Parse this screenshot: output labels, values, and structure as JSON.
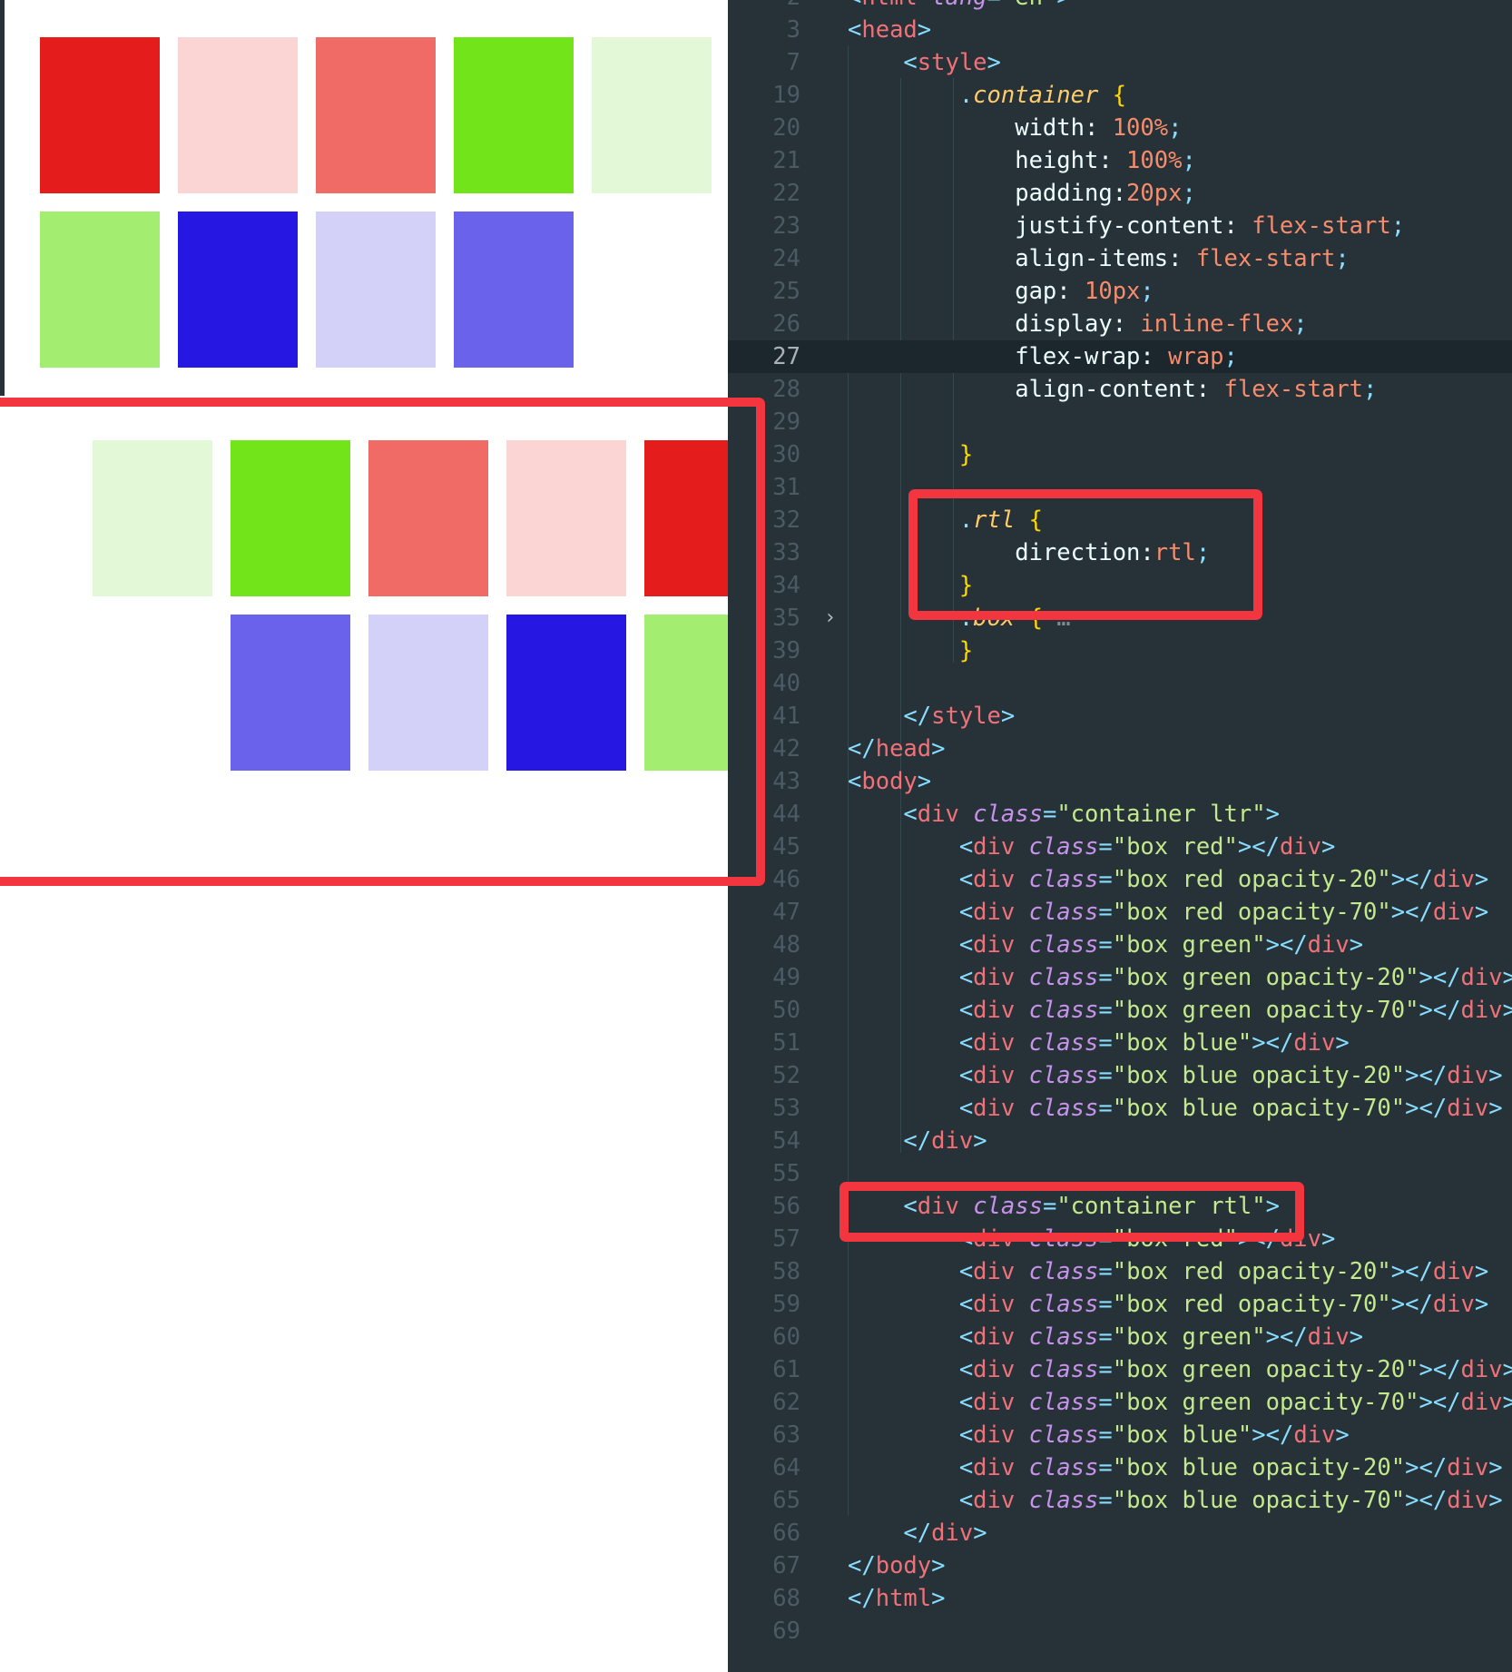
{
  "preview": {
    "colors": {
      "red": "#e41c1c",
      "red_20": "#fbd5d4",
      "red_70": "#f06a66",
      "green": "#72e51a",
      "green_20": "#e2f8d7",
      "green_70": "#a3ee70",
      "blue": "#2617e3",
      "blue_20": "#d4d1f8",
      "blue_70": "#6a62ea"
    },
    "ltr_boxes": [
      "red",
      "red_20",
      "red_70",
      "green",
      "green_20",
      "green_70",
      "blue",
      "blue_20",
      "blue_70"
    ],
    "rtl_boxes": [
      "red",
      "red_20",
      "red_70",
      "green",
      "green_20",
      "green_70",
      "blue",
      "blue_20",
      "blue_70"
    ],
    "highlight_color": "#f2353f"
  },
  "editor": {
    "current_line": 27,
    "lines": [
      {
        "n": 2,
        "c": [
          [
            "t-br",
            "<"
          ],
          [
            "t-tag",
            "html "
          ],
          [
            "t-attr",
            "lang"
          ],
          [
            "t-br",
            "="
          ],
          [
            "t-str",
            "\"en\""
          ],
          [
            "t-br",
            ">"
          ]
        ]
      },
      {
        "n": 3,
        "c": [
          [
            "t-br",
            "<"
          ],
          [
            "t-tag",
            "head"
          ],
          [
            "t-br",
            ">"
          ]
        ]
      },
      {
        "n": 7,
        "c": [
          [
            "t-br",
            "    <"
          ],
          [
            "t-tag",
            "style"
          ],
          [
            "t-br",
            ">"
          ]
        ]
      },
      {
        "n": 19,
        "c": [
          [
            "t-punc",
            "        ."
          ],
          [
            "t-sel",
            "container "
          ],
          [
            "t-curly",
            "{"
          ]
        ]
      },
      {
        "n": 20,
        "c": [
          [
            "t-prop",
            "            width: "
          ],
          [
            "t-num",
            "100%"
          ],
          [
            "t-punc",
            ";"
          ]
        ]
      },
      {
        "n": 21,
        "c": [
          [
            "t-prop",
            "            height: "
          ],
          [
            "t-num",
            "100%"
          ],
          [
            "t-punc",
            ";"
          ]
        ]
      },
      {
        "n": 22,
        "c": [
          [
            "t-prop",
            "            padding:"
          ],
          [
            "t-num",
            "20px"
          ],
          [
            "t-punc",
            ";"
          ]
        ]
      },
      {
        "n": 23,
        "c": [
          [
            "t-prop",
            "            justify-content: "
          ],
          [
            "t-val",
            "flex-start"
          ],
          [
            "t-punc",
            ";"
          ]
        ]
      },
      {
        "n": 24,
        "c": [
          [
            "t-prop",
            "            align-items: "
          ],
          [
            "t-val",
            "flex-start"
          ],
          [
            "t-punc",
            ";"
          ]
        ]
      },
      {
        "n": 25,
        "c": [
          [
            "t-prop",
            "            gap: "
          ],
          [
            "t-num",
            "10px"
          ],
          [
            "t-punc",
            ";"
          ]
        ]
      },
      {
        "n": 26,
        "c": [
          [
            "t-prop",
            "            display: "
          ],
          [
            "t-val",
            "inline-flex"
          ],
          [
            "t-punc",
            ";"
          ]
        ]
      },
      {
        "n": 27,
        "c": [
          [
            "t-prop",
            "            flex-wrap: "
          ],
          [
            "t-val",
            "wrap"
          ],
          [
            "t-punc",
            ";"
          ]
        ]
      },
      {
        "n": 28,
        "c": [
          [
            "t-prop",
            "            align-content: "
          ],
          [
            "t-val",
            "flex-start"
          ],
          [
            "t-punc",
            ";"
          ]
        ]
      },
      {
        "n": 29,
        "c": []
      },
      {
        "n": 30,
        "c": [
          [
            "t-curly",
            "        }"
          ]
        ]
      },
      {
        "n": 31,
        "c": []
      },
      {
        "n": 32,
        "c": [
          [
            "t-punc",
            "        ."
          ],
          [
            "t-sel",
            "rtl "
          ],
          [
            "t-curly",
            "{"
          ]
        ]
      },
      {
        "n": 33,
        "c": [
          [
            "t-prop",
            "            direction:"
          ],
          [
            "t-val",
            "rtl"
          ],
          [
            "t-punc",
            ";"
          ]
        ]
      },
      {
        "n": 34,
        "c": [
          [
            "t-curly",
            "        }"
          ]
        ]
      },
      {
        "n": 35,
        "c": [
          [
            "t-punc",
            "        ."
          ],
          [
            "t-sel",
            "box "
          ],
          [
            "t-curly",
            "{"
          ],
          [
            "t-dim",
            " …"
          ]
        ]
      },
      {
        "n": 39,
        "c": [
          [
            "t-curly",
            "        }"
          ]
        ]
      },
      {
        "n": 40,
        "c": []
      },
      {
        "n": 41,
        "c": [
          [
            "t-br",
            "    </"
          ],
          [
            "t-tag",
            "style"
          ],
          [
            "t-br",
            ">"
          ]
        ]
      },
      {
        "n": 42,
        "c": [
          [
            "t-br",
            "</"
          ],
          [
            "t-tag",
            "head"
          ],
          [
            "t-br",
            ">"
          ]
        ]
      },
      {
        "n": 43,
        "c": [
          [
            "t-br",
            "<"
          ],
          [
            "t-tag",
            "body"
          ],
          [
            "t-br",
            ">"
          ]
        ]
      },
      {
        "n": 44,
        "c": [
          [
            "t-br",
            "    <"
          ],
          [
            "t-tag",
            "div "
          ],
          [
            "t-attr",
            "class"
          ],
          [
            "t-br",
            "="
          ],
          [
            "t-str",
            "\"container ltr\""
          ],
          [
            "t-br",
            ">"
          ]
        ]
      },
      {
        "n": 45,
        "c": [
          [
            "t-br",
            "        <"
          ],
          [
            "t-tag",
            "div "
          ],
          [
            "t-attr",
            "class"
          ],
          [
            "t-br",
            "="
          ],
          [
            "t-str",
            "\"box red\""
          ],
          [
            "t-br",
            "></"
          ],
          [
            "t-tag",
            "div"
          ],
          [
            "t-br",
            ">"
          ]
        ]
      },
      {
        "n": 46,
        "c": [
          [
            "t-br",
            "        <"
          ],
          [
            "t-tag",
            "div "
          ],
          [
            "t-attr",
            "class"
          ],
          [
            "t-br",
            "="
          ],
          [
            "t-str",
            "\"box red opacity-20\""
          ],
          [
            "t-br",
            "></"
          ],
          [
            "t-tag",
            "div"
          ],
          [
            "t-br",
            ">"
          ]
        ]
      },
      {
        "n": 47,
        "c": [
          [
            "t-br",
            "        <"
          ],
          [
            "t-tag",
            "div "
          ],
          [
            "t-attr",
            "class"
          ],
          [
            "t-br",
            "="
          ],
          [
            "t-str",
            "\"box red opacity-70\""
          ],
          [
            "t-br",
            "></"
          ],
          [
            "t-tag",
            "div"
          ],
          [
            "t-br",
            ">"
          ]
        ]
      },
      {
        "n": 48,
        "c": [
          [
            "t-br",
            "        <"
          ],
          [
            "t-tag",
            "div "
          ],
          [
            "t-attr",
            "class"
          ],
          [
            "t-br",
            "="
          ],
          [
            "t-str",
            "\"box green\""
          ],
          [
            "t-br",
            "></"
          ],
          [
            "t-tag",
            "div"
          ],
          [
            "t-br",
            ">"
          ]
        ]
      },
      {
        "n": 49,
        "c": [
          [
            "t-br",
            "        <"
          ],
          [
            "t-tag",
            "div "
          ],
          [
            "t-attr",
            "class"
          ],
          [
            "t-br",
            "="
          ],
          [
            "t-str",
            "\"box green opacity-20\""
          ],
          [
            "t-br",
            "></"
          ],
          [
            "t-tag",
            "div"
          ],
          [
            "t-br",
            ">"
          ]
        ]
      },
      {
        "n": 50,
        "c": [
          [
            "t-br",
            "        <"
          ],
          [
            "t-tag",
            "div "
          ],
          [
            "t-attr",
            "class"
          ],
          [
            "t-br",
            "="
          ],
          [
            "t-str",
            "\"box green opacity-70\""
          ],
          [
            "t-br",
            "></"
          ],
          [
            "t-tag",
            "div"
          ],
          [
            "t-br",
            ">"
          ]
        ]
      },
      {
        "n": 51,
        "c": [
          [
            "t-br",
            "        <"
          ],
          [
            "t-tag",
            "div "
          ],
          [
            "t-attr",
            "class"
          ],
          [
            "t-br",
            "="
          ],
          [
            "t-str",
            "\"box blue\""
          ],
          [
            "t-br",
            "></"
          ],
          [
            "t-tag",
            "div"
          ],
          [
            "t-br",
            ">"
          ]
        ]
      },
      {
        "n": 52,
        "c": [
          [
            "t-br",
            "        <"
          ],
          [
            "t-tag",
            "div "
          ],
          [
            "t-attr",
            "class"
          ],
          [
            "t-br",
            "="
          ],
          [
            "t-str",
            "\"box blue opacity-20\""
          ],
          [
            "t-br",
            "></"
          ],
          [
            "t-tag",
            "div"
          ],
          [
            "t-br",
            ">"
          ]
        ]
      },
      {
        "n": 53,
        "c": [
          [
            "t-br",
            "        <"
          ],
          [
            "t-tag",
            "div "
          ],
          [
            "t-attr",
            "class"
          ],
          [
            "t-br",
            "="
          ],
          [
            "t-str",
            "\"box blue opacity-70\""
          ],
          [
            "t-br",
            "></"
          ],
          [
            "t-tag",
            "div"
          ],
          [
            "t-br",
            ">"
          ]
        ]
      },
      {
        "n": 54,
        "c": [
          [
            "t-br",
            "    </"
          ],
          [
            "t-tag",
            "div"
          ],
          [
            "t-br",
            ">"
          ]
        ]
      },
      {
        "n": 55,
        "c": []
      },
      {
        "n": 56,
        "c": [
          [
            "t-br",
            "    <"
          ],
          [
            "t-tag",
            "div "
          ],
          [
            "t-attr",
            "class"
          ],
          [
            "t-br",
            "="
          ],
          [
            "t-str",
            "\"container rtl\""
          ],
          [
            "t-br",
            ">"
          ]
        ]
      },
      {
        "n": 57,
        "c": [
          [
            "t-br",
            "        <"
          ],
          [
            "t-tag",
            "div "
          ],
          [
            "t-attr",
            "class"
          ],
          [
            "t-br",
            "="
          ],
          [
            "t-str",
            "\"box red\""
          ],
          [
            "t-br",
            "></"
          ],
          [
            "t-tag",
            "div"
          ],
          [
            "t-br",
            ">"
          ]
        ]
      },
      {
        "n": 58,
        "c": [
          [
            "t-br",
            "        <"
          ],
          [
            "t-tag",
            "div "
          ],
          [
            "t-attr",
            "class"
          ],
          [
            "t-br",
            "="
          ],
          [
            "t-str",
            "\"box red opacity-20\""
          ],
          [
            "t-br",
            "></"
          ],
          [
            "t-tag",
            "div"
          ],
          [
            "t-br",
            ">"
          ]
        ]
      },
      {
        "n": 59,
        "c": [
          [
            "t-br",
            "        <"
          ],
          [
            "t-tag",
            "div "
          ],
          [
            "t-attr",
            "class"
          ],
          [
            "t-br",
            "="
          ],
          [
            "t-str",
            "\"box red opacity-70\""
          ],
          [
            "t-br",
            "></"
          ],
          [
            "t-tag",
            "div"
          ],
          [
            "t-br",
            ">"
          ]
        ]
      },
      {
        "n": 60,
        "c": [
          [
            "t-br",
            "        <"
          ],
          [
            "t-tag",
            "div "
          ],
          [
            "t-attr",
            "class"
          ],
          [
            "t-br",
            "="
          ],
          [
            "t-str",
            "\"box green\""
          ],
          [
            "t-br",
            "></"
          ],
          [
            "t-tag",
            "div"
          ],
          [
            "t-br",
            ">"
          ]
        ]
      },
      {
        "n": 61,
        "c": [
          [
            "t-br",
            "        <"
          ],
          [
            "t-tag",
            "div "
          ],
          [
            "t-attr",
            "class"
          ],
          [
            "t-br",
            "="
          ],
          [
            "t-str",
            "\"box green opacity-20\""
          ],
          [
            "t-br",
            "></"
          ],
          [
            "t-tag",
            "div"
          ],
          [
            "t-br",
            ">"
          ]
        ]
      },
      {
        "n": 62,
        "c": [
          [
            "t-br",
            "        <"
          ],
          [
            "t-tag",
            "div "
          ],
          [
            "t-attr",
            "class"
          ],
          [
            "t-br",
            "="
          ],
          [
            "t-str",
            "\"box green opacity-70\""
          ],
          [
            "t-br",
            "></"
          ],
          [
            "t-tag",
            "div"
          ],
          [
            "t-br",
            ">"
          ]
        ]
      },
      {
        "n": 63,
        "c": [
          [
            "t-br",
            "        <"
          ],
          [
            "t-tag",
            "div "
          ],
          [
            "t-attr",
            "class"
          ],
          [
            "t-br",
            "="
          ],
          [
            "t-str",
            "\"box blue\""
          ],
          [
            "t-br",
            "></"
          ],
          [
            "t-tag",
            "div"
          ],
          [
            "t-br",
            ">"
          ]
        ]
      },
      {
        "n": 64,
        "c": [
          [
            "t-br",
            "        <"
          ],
          [
            "t-tag",
            "div "
          ],
          [
            "t-attr",
            "class"
          ],
          [
            "t-br",
            "="
          ],
          [
            "t-str",
            "\"box blue opacity-20\""
          ],
          [
            "t-br",
            "></"
          ],
          [
            "t-tag",
            "div"
          ],
          [
            "t-br",
            ">"
          ]
        ]
      },
      {
        "n": 65,
        "c": [
          [
            "t-br",
            "        <"
          ],
          [
            "t-tag",
            "div "
          ],
          [
            "t-attr",
            "class"
          ],
          [
            "t-br",
            "="
          ],
          [
            "t-str",
            "\"box blue opacity-70\""
          ],
          [
            "t-br",
            "></"
          ],
          [
            "t-tag",
            "div"
          ],
          [
            "t-br",
            ">"
          ]
        ]
      },
      {
        "n": 66,
        "c": [
          [
            "t-br",
            "    </"
          ],
          [
            "t-tag",
            "div"
          ],
          [
            "t-br",
            ">"
          ]
        ]
      },
      {
        "n": 67,
        "c": [
          [
            "t-br",
            "</"
          ],
          [
            "t-tag",
            "body"
          ],
          [
            "t-br",
            ">"
          ]
        ]
      },
      {
        "n": 68,
        "c": [
          [
            "t-br",
            "</"
          ],
          [
            "t-tag",
            "html"
          ],
          [
            "t-br",
            ">"
          ]
        ]
      },
      {
        "n": 69,
        "c": []
      }
    ]
  }
}
